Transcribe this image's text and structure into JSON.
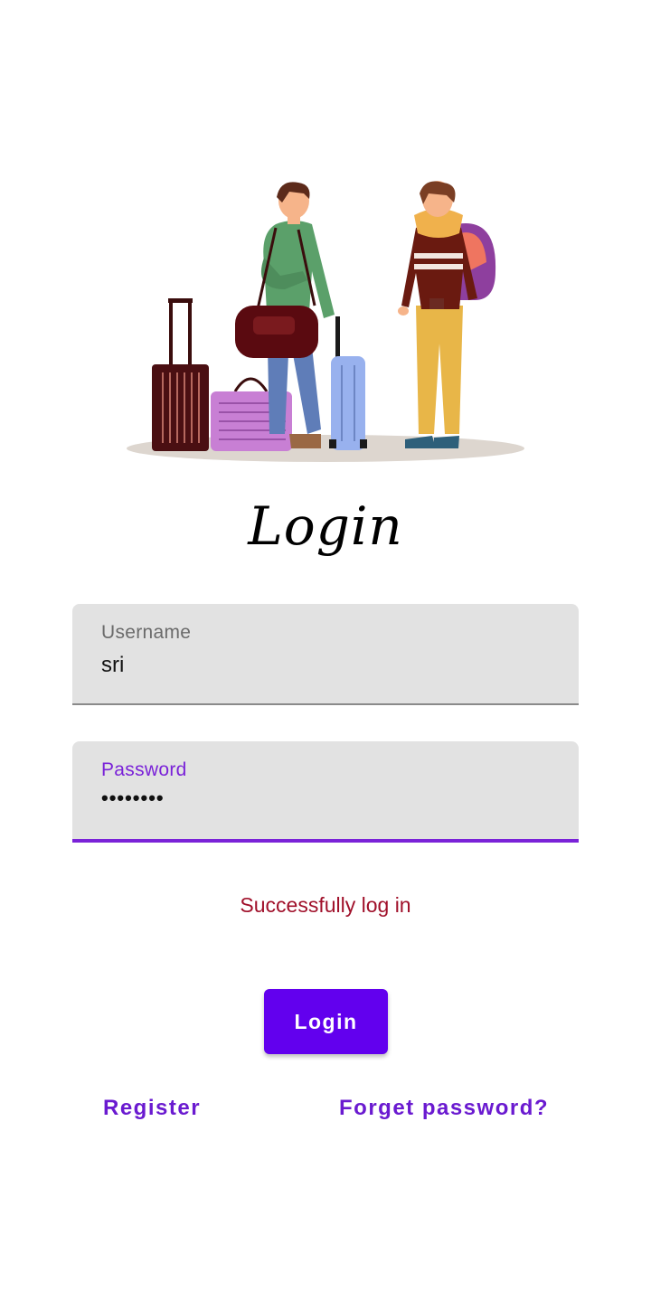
{
  "app": {
    "title": "Login"
  },
  "form": {
    "username": {
      "label": "Username",
      "value": "sri"
    },
    "password": {
      "label": "Password",
      "value": "••••••••"
    }
  },
  "status_message": "Successfully log in",
  "actions": {
    "login_label": "Login",
    "register_label": "Register",
    "forget_label": "Forget password?"
  },
  "colors": {
    "primary": "#6200ee",
    "status": "#a0102a",
    "field_bg": "#e2e2e2"
  },
  "icons": {
    "illustration": "travelers-with-luggage-illustration"
  }
}
